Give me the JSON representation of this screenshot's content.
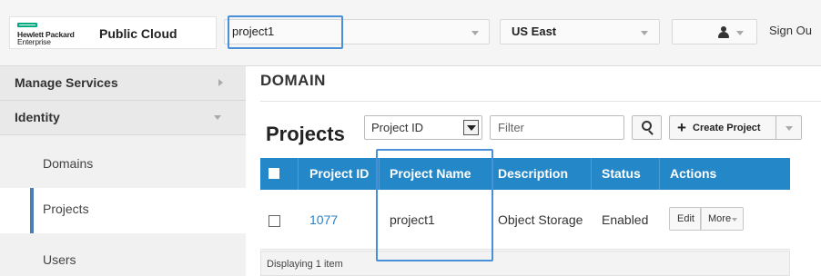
{
  "header": {
    "brand": {
      "logo_line1": "Hewlett Packard",
      "logo_line2": "Enterprise",
      "product": "Public Cloud"
    },
    "project_selector": {
      "value": "project1",
      "icon": "chevron-down-icon"
    },
    "region_selector": {
      "value": "US East",
      "icon": "chevron-down-icon"
    },
    "user_menu": {
      "icon": "user-icon"
    },
    "sign_out": "Sign Ou"
  },
  "sidebar": {
    "sections": [
      {
        "label": "Manage Services",
        "icon": "chevron-right-icon"
      },
      {
        "label": "Identity",
        "icon": "chevron-down-icon"
      }
    ],
    "items": [
      {
        "label": "Domains",
        "active": false
      },
      {
        "label": "Projects",
        "active": true
      },
      {
        "label": "Users",
        "active": false
      }
    ]
  },
  "main": {
    "section_title": "DOMAIN",
    "page_title": "Projects",
    "toolbar": {
      "filter_field": "Project ID",
      "filter_placeholder": "Filter",
      "search_icon": "search-icon",
      "create_label": "Create Project",
      "create_icon": "plus-icon"
    },
    "table": {
      "columns": [
        "Project ID",
        "Project Name",
        "Description",
        "Status",
        "Actions"
      ],
      "rows": [
        {
          "project_id": "1077",
          "project_name": "project1",
          "description": "Object Storage",
          "status": "Enabled",
          "actions": {
            "edit": "Edit",
            "more": "More"
          }
        }
      ],
      "footer": "Displaying 1 item"
    }
  },
  "colors": {
    "table_header": "#2487c8",
    "link": "#2e80c2",
    "highlight": "#4a90d9",
    "hpe_green": "#01a982",
    "active_marker": "#4a7fb5"
  }
}
